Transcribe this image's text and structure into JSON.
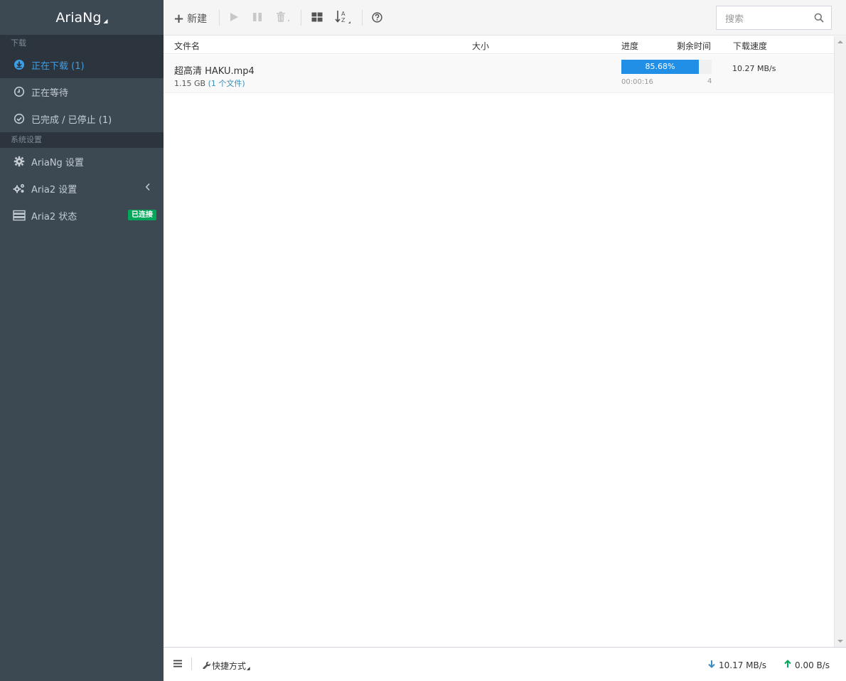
{
  "brand": "AriaNg",
  "sidebar": {
    "download_header": "下载",
    "downloading": "正在下载 (1)",
    "waiting": "正在等待",
    "stopped": "已完成 / 已停止 (1)",
    "settings_header": "系统设置",
    "ariang_settings": "AriaNg 设置",
    "aria2_settings": "Aria2 设置",
    "aria2_status": "Aria2 状态",
    "connected_badge": "已连接"
  },
  "toolbar": {
    "new_label": "新建",
    "search_placeholder": "搜索"
  },
  "table": {
    "headers": {
      "name": "文件名",
      "size": "大小",
      "progress": "进度",
      "remaining": "剩余时间",
      "speed": "下载速度"
    },
    "rows": [
      {
        "name": "超高清 HAKU.mp4",
        "size": "1.15 GB",
        "files": "(1 个文件)",
        "progress_text": "85.68%",
        "progress_value": 85.68,
        "remaining": "00:00:16",
        "connections": "4",
        "speed": "10.27 MB/s"
      }
    ]
  },
  "footer": {
    "shortcut": "快捷方式",
    "download_speed": "10.17 MB/s",
    "upload_speed": "0.00 B/s"
  },
  "colors": {
    "sidebar_bg": "#3c4852",
    "active": "#3c9ee5",
    "progress": "#208fe5",
    "badge": "#00a65a",
    "download_arrow": "#3c8dbc",
    "upload_arrow": "#00a65a"
  }
}
